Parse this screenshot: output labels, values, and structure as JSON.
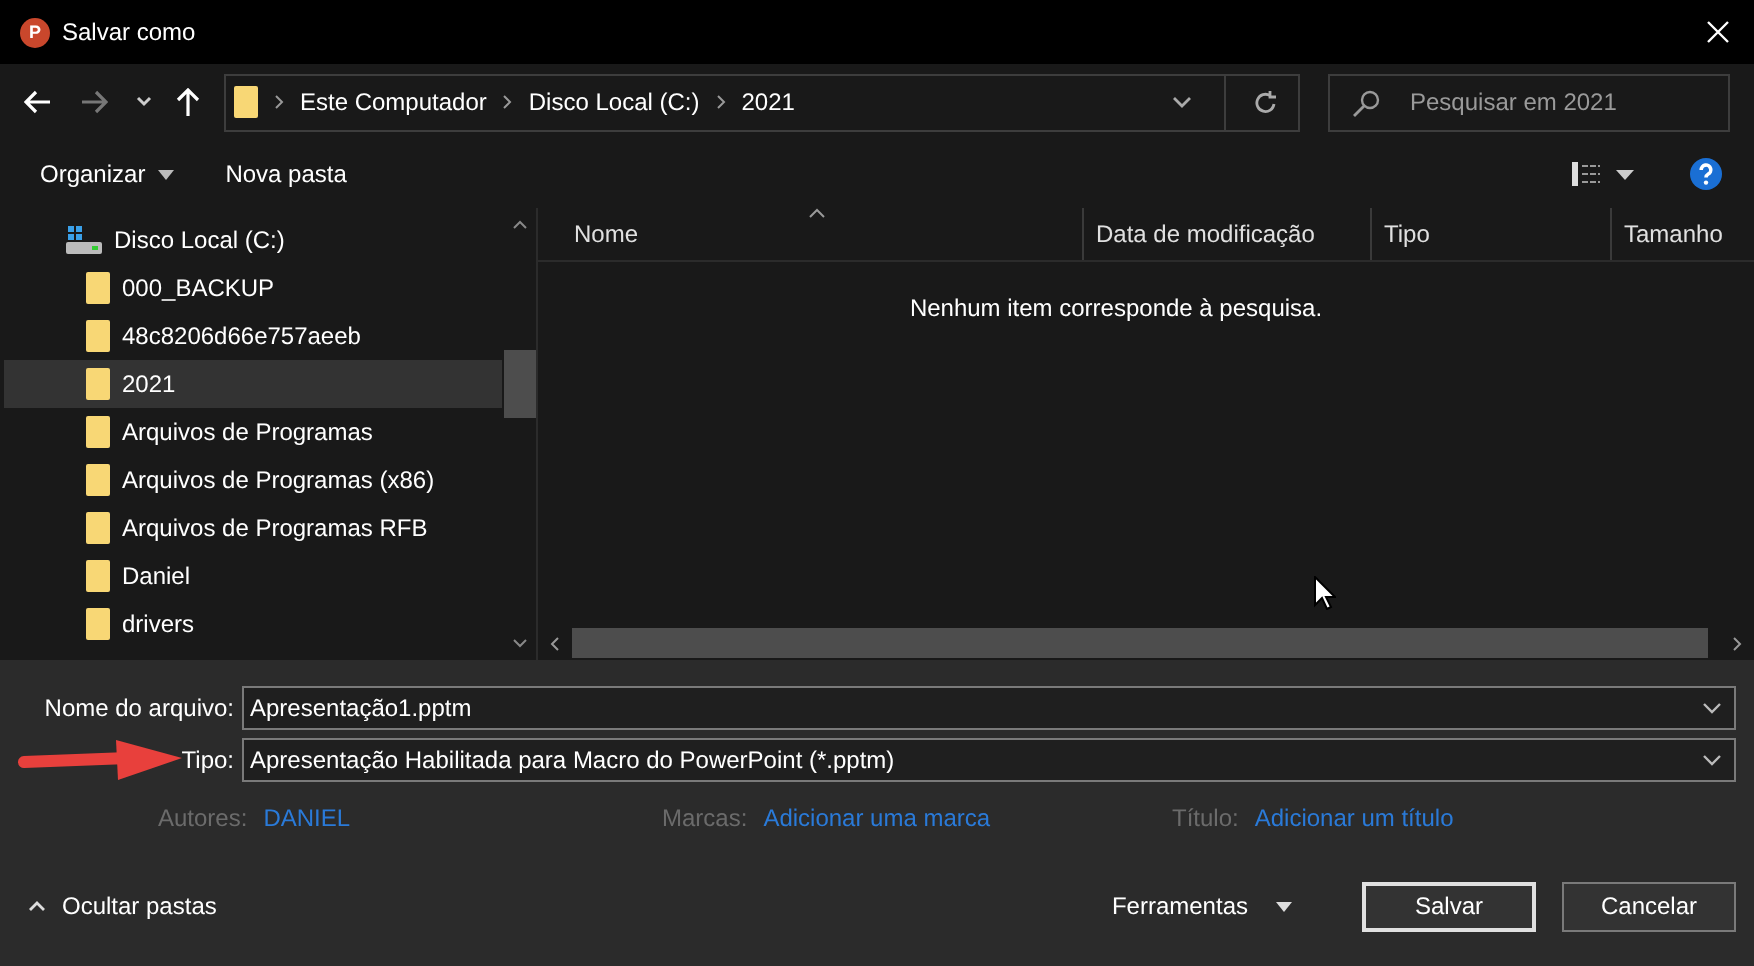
{
  "window": {
    "title": "Salvar como",
    "app_icon_letter": "P"
  },
  "address": {
    "crumbs": [
      "Este Computador",
      "Disco Local (C:)",
      "2021"
    ],
    "search_placeholder": "Pesquisar em 2021"
  },
  "toolbar": {
    "organize": "Organizar",
    "new_folder": "Nova pasta"
  },
  "sidebar": {
    "items": [
      {
        "label": "Disco Local (C:)",
        "kind": "drive",
        "selected": false
      },
      {
        "label": "000_BACKUP",
        "kind": "folder",
        "selected": false
      },
      {
        "label": "48c8206d66e757aeeb",
        "kind": "folder",
        "selected": false
      },
      {
        "label": "2021",
        "kind": "folder",
        "selected": true
      },
      {
        "label": "Arquivos de Programas",
        "kind": "folder",
        "selected": false
      },
      {
        "label": "Arquivos de Programas (x86)",
        "kind": "folder",
        "selected": false
      },
      {
        "label": "Arquivos de Programas RFB",
        "kind": "folder",
        "selected": false
      },
      {
        "label": "Daniel",
        "kind": "folder",
        "selected": false
      },
      {
        "label": "drivers",
        "kind": "folder",
        "selected": false
      }
    ]
  },
  "file_list": {
    "columns": [
      {
        "label": "Nome",
        "sorted": true
      },
      {
        "label": "Data de modificação",
        "sorted": false
      },
      {
        "label": "Tipo",
        "sorted": false
      },
      {
        "label": "Tamanho",
        "sorted": false
      }
    ],
    "empty_message": "Nenhum item corresponde à pesquisa."
  },
  "form": {
    "fields": [
      {
        "label": "Nome do arquivo:",
        "value": "Apresentação1.pptm",
        "highlighted": false
      },
      {
        "label": "Tipo:",
        "value": "Apresentação Habilitada para Macro do PowerPoint (*.pptm)",
        "highlighted": true
      }
    ],
    "metadata": [
      {
        "label": "Autores:",
        "value": "DANIEL"
      },
      {
        "label": "Marcas:",
        "value": "Adicionar uma marca"
      },
      {
        "label": "Título:",
        "value": "Adicionar um título"
      }
    ]
  },
  "footer": {
    "hide_folders": "Ocultar pastas",
    "tools": "Ferramentas",
    "buttons": [
      {
        "label": "Salvar",
        "default": true
      },
      {
        "label": "Cancelar",
        "default": false
      }
    ]
  }
}
